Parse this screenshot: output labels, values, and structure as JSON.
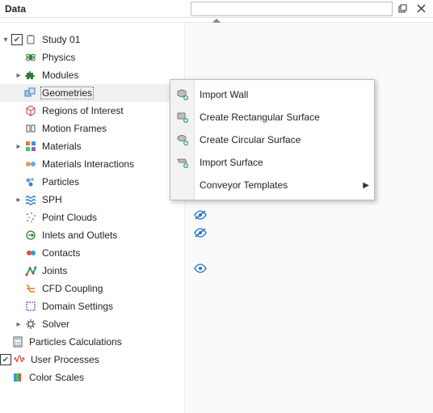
{
  "header": {
    "title": "Data",
    "search_value": ""
  },
  "tree": {
    "study": "Study 01",
    "physics": "Physics",
    "modules": "Modules",
    "geometries": "Geometries",
    "roi": "Regions of Interest",
    "motion_frames": "Motion Frames",
    "materials": "Materials",
    "mat_interactions": "Materials Interactions",
    "particles": "Particles",
    "sph": "SPH",
    "point_clouds": "Point Clouds",
    "inlets_outlets": "Inlets and Outlets",
    "contacts": "Contacts",
    "joints": "Joints",
    "cfd": "CFD Coupling",
    "domain": "Domain Settings",
    "solver": "Solver",
    "particles_calc": "Particles Calculations",
    "user_processes": "User Processes",
    "color_scales": "Color Scales"
  },
  "menu": {
    "import_wall": "Import Wall",
    "create_rect": "Create Rectangular Surface",
    "create_circ": "Create Circular Surface",
    "import_surface": "Import Surface",
    "conveyor": "Conveyor Templates"
  }
}
